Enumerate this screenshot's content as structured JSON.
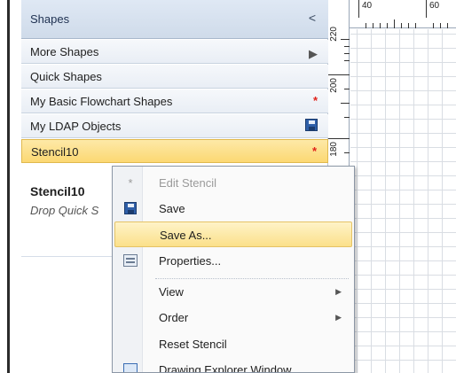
{
  "pane": {
    "title": "Shapes",
    "collapse_glyph": "<",
    "rows": [
      {
        "label": "More Shapes",
        "right": "▶"
      },
      {
        "label": "Quick Shapes",
        "right": ""
      },
      {
        "label": "My Basic Flowchart Shapes",
        "right": "*"
      },
      {
        "label": "My LDAP Objects",
        "right": "save-icon"
      },
      {
        "label": "Stencil10",
        "right": "*"
      }
    ],
    "stencil_title": "Stencil10",
    "stencil_hint": "Drop Quick S"
  },
  "ruler": {
    "h_labels": [
      "40",
      "60"
    ],
    "v_labels": [
      "220",
      "200",
      "180"
    ]
  },
  "menu": {
    "items": [
      {
        "label": "Edit Stencil",
        "icon": "*",
        "disabled": true
      },
      {
        "label": "Save",
        "icon": "save-icon"
      },
      {
        "label": "Save As...",
        "hover": true
      },
      {
        "label": "Properties...",
        "icon": "properties-icon"
      },
      {
        "label": "View",
        "submenu": true
      },
      {
        "label": "Order",
        "submenu": true
      },
      {
        "label": "Reset Stencil"
      },
      {
        "label": "Drawing Explorer Window",
        "icon": "explorer-icon"
      }
    ]
  },
  "colors": {
    "selection": "#fcd873",
    "modified_star": "#e0221a",
    "accent_blue": "#2f5fa8"
  }
}
